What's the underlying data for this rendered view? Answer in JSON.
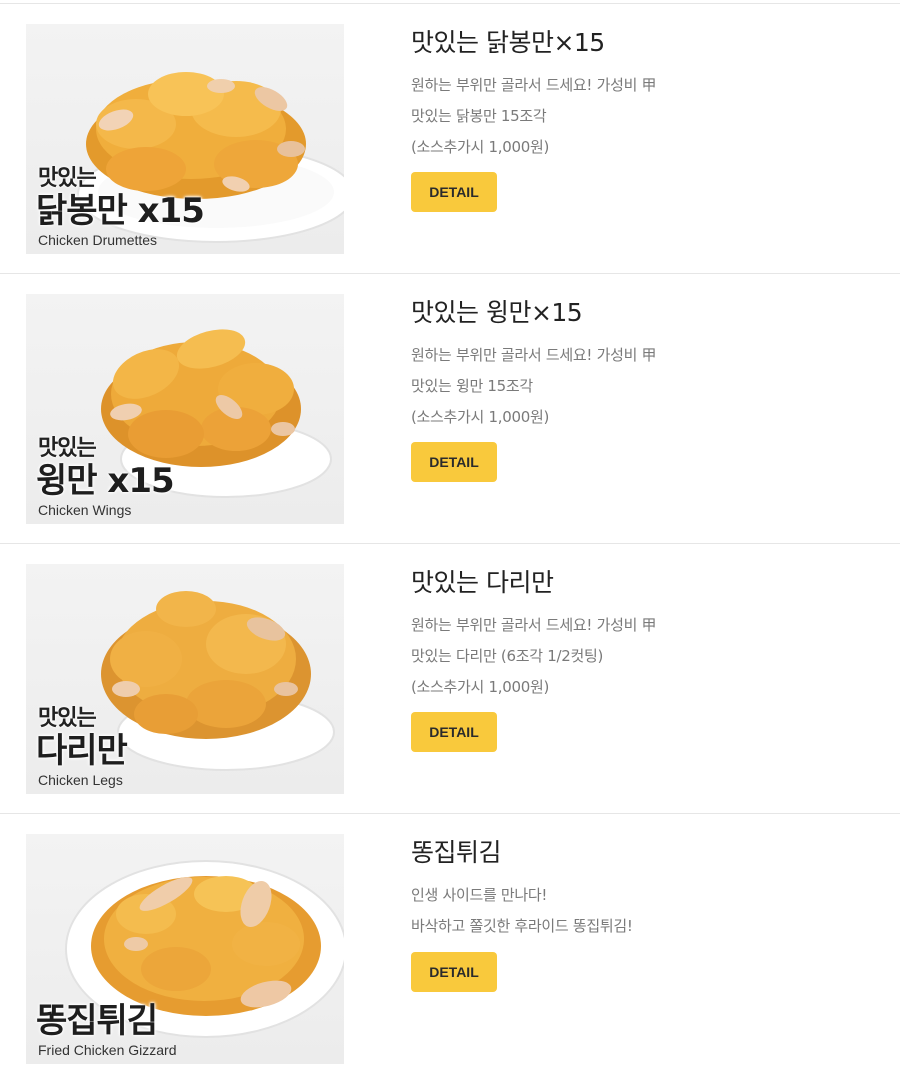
{
  "menu": [
    {
      "title": "맛있는 닭봉만×15",
      "desc": [
        "원하는 부위만 골라서 드세요! 가성비 甲",
        "맛있는 닭봉만 15조각",
        "(소스추가시 1,000원)"
      ],
      "photo": {
        "label_small": "맛있는",
        "label_big": "닭봉만 x15",
        "label_en": "Chicken Drumettes"
      },
      "button": "DETAIL"
    },
    {
      "title": "맛있는 윙만×15",
      "desc": [
        "원하는 부위만 골라서 드세요! 가성비 甲",
        "맛있는 윙만 15조각",
        "(소스추가시 1,000원)"
      ],
      "photo": {
        "label_small": "맛있는",
        "label_big": "윙만 x15",
        "label_en": "Chicken Wings"
      },
      "button": "DETAIL"
    },
    {
      "title": "맛있는 다리만",
      "desc": [
        "원하는 부위만 골라서 드세요! 가성비 甲",
        "맛있는 다리만 (6조각 1/2컷팅)",
        "(소스추가시 1,000원)"
      ],
      "photo": {
        "label_small": "맛있는",
        "label_big": "다리만",
        "label_en": "Chicken Legs"
      },
      "button": "DETAIL"
    },
    {
      "title": "똥집튀김",
      "desc": [
        "인생 사이드를 만나다!",
        "바삭하고 쫄깃한 후라이드 똥집튀김!"
      ],
      "photo": {
        "label_small": "",
        "label_big": "똥집튀김",
        "label_en": "Fried Chicken Gizzard"
      },
      "button": "DETAIL"
    }
  ],
  "colors": {
    "button_bg": "#f9c93c",
    "title": "#222222",
    "desc": "#7a7a7a",
    "divider": "#e6e6e6"
  }
}
